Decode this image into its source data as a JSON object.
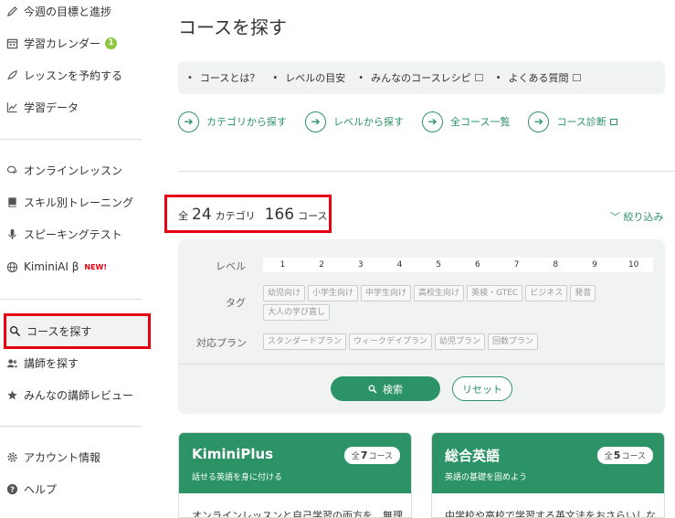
{
  "sidebar": {
    "items": [
      {
        "label": "今週の目標と進捗",
        "icon": "pencil-icon"
      },
      {
        "label": "学習カレンダー",
        "icon": "calendar-icon",
        "badge": "1"
      },
      {
        "label": "レッスンを予約する",
        "icon": "feather-icon"
      },
      {
        "label": "学習データ",
        "icon": "chart-line-icon"
      },
      {
        "label": "オンラインレッスン",
        "icon": "chat-bubbles-icon"
      },
      {
        "label": "スキル別トレーニング",
        "icon": "book-icon"
      },
      {
        "label": "スピーキングテスト",
        "icon": "microphone-icon"
      },
      {
        "label": "KiminiAI β",
        "icon": "globe-icon",
        "tag": "NEW!"
      },
      {
        "label": "コースを探す",
        "icon": "search-icon"
      },
      {
        "label": "講師を探す",
        "icon": "users-icon"
      },
      {
        "label": "みんなの講師レビュー",
        "icon": "star-icon"
      },
      {
        "label": "アカウント情報",
        "icon": "gear-icon"
      },
      {
        "label": "ヘルプ",
        "icon": "help-icon"
      }
    ]
  },
  "main": {
    "title": "コースを探す",
    "links": [
      {
        "label": "コースとは？"
      },
      {
        "label": "レベルの目安"
      },
      {
        "label": "みんなのコースレシピ"
      },
      {
        "label": "よくある質問"
      }
    ],
    "nav": [
      {
        "label": "カテゴリから探す"
      },
      {
        "label": "レベルから探す"
      },
      {
        "label": "全コース一覧"
      },
      {
        "label": "コース診断"
      }
    ],
    "count": {
      "prefix": "全",
      "categories": "24",
      "categories_unit": "カテゴリ",
      "courses": "166",
      "courses_unit": "コース"
    },
    "filter_toggle": "絞り込み",
    "filter": {
      "level_label": "レベル",
      "levels": [
        "1",
        "2",
        "3",
        "4",
        "5",
        "6",
        "7",
        "8",
        "9",
        "10"
      ],
      "tag_label": "タグ",
      "tags": [
        "幼児向け",
        "小学生向け",
        "中学生向け",
        "高校生向け",
        "英検・GTEC",
        "ビジネス",
        "発音",
        "大人の学び直し"
      ],
      "plan_label": "対応プラン",
      "plans": [
        "スタンダードプラン",
        "ウィークデイプラン",
        "幼児プラン",
        "回数プラン"
      ],
      "search_button": "検索",
      "reset_button": "リセット"
    },
    "cards": [
      {
        "title": "KiminiPlus",
        "subtitle": "話せる英語を身に付ける",
        "count_prefix": "全",
        "count": "7",
        "count_unit": "コース",
        "desc": "オンラインレッスンと自己学習の両方を、無理"
      },
      {
        "title": "総合英語",
        "subtitle": "英語の基礎を固めよう",
        "count_prefix": "全",
        "count": "5",
        "count_unit": "コース",
        "desc": "中学校や高校で学習する英文法をおさらいしな"
      }
    ]
  },
  "colors": {
    "accent": "#2b9365",
    "highlight": "#e60012",
    "panel": "#f1f3f3"
  }
}
